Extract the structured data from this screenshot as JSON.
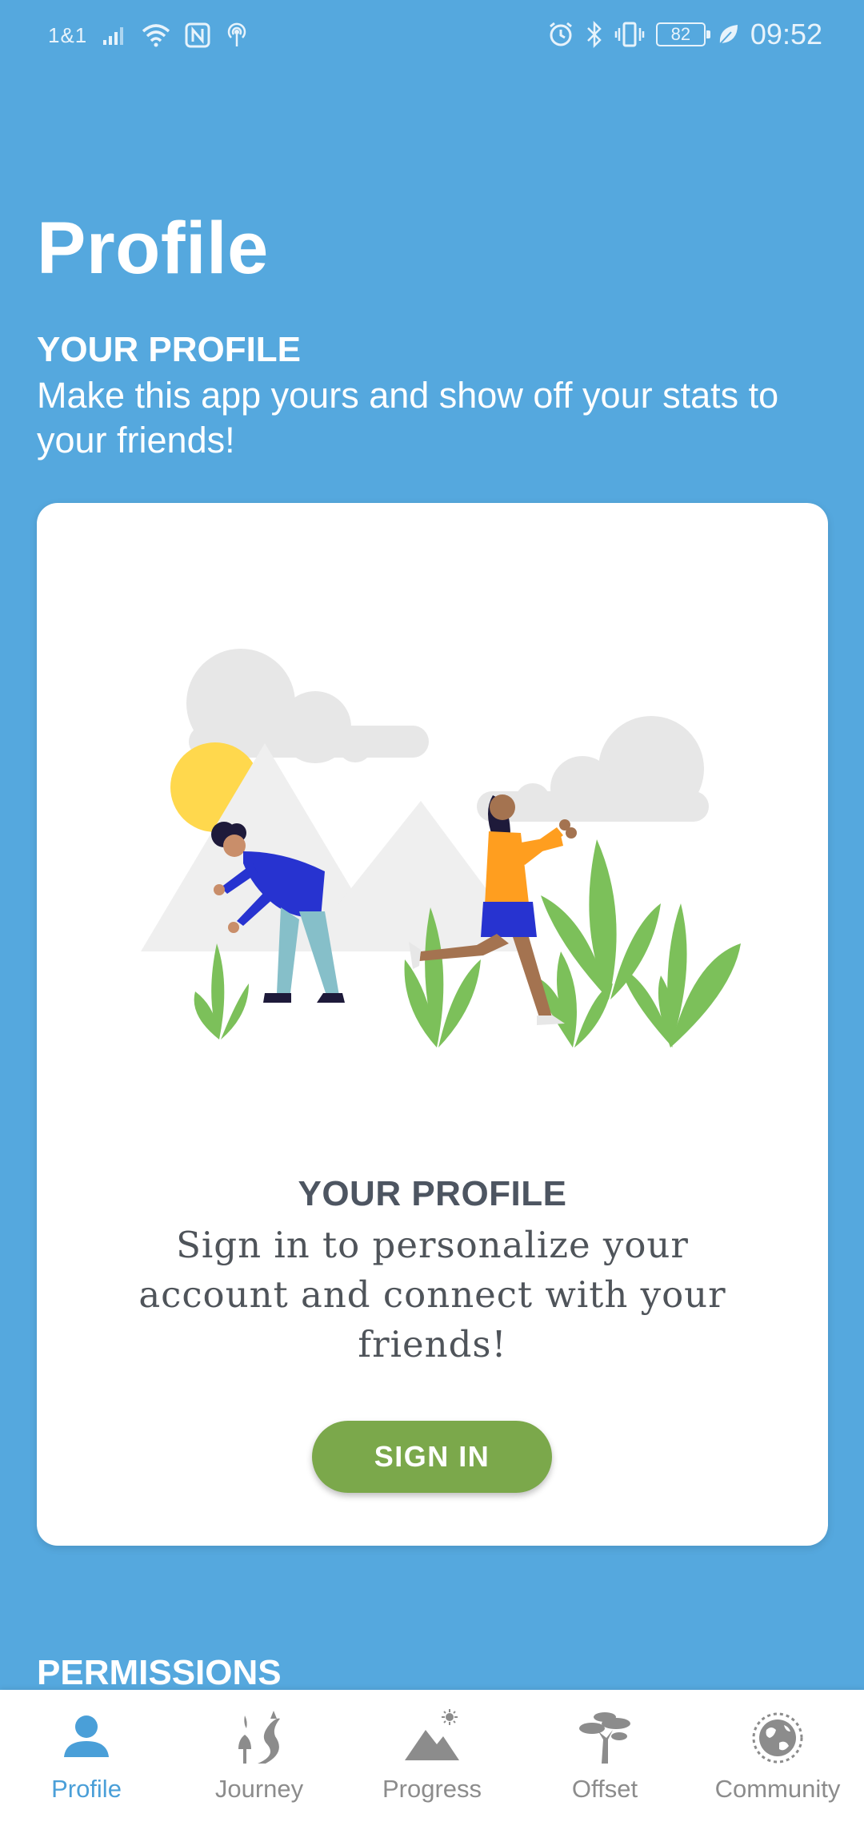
{
  "status_bar": {
    "carrier": "1&1",
    "battery": "82",
    "time": "09:52",
    "icons": [
      "signal-icon",
      "wifi-icon",
      "nfc-icon",
      "hotspot-icon",
      "alarm-icon",
      "bluetooth-icon",
      "vibrate-icon",
      "battery-icon",
      "leaf-icon"
    ]
  },
  "header": {
    "title": "Profile",
    "section_heading": "YOUR PROFILE",
    "section_subtitle": "Make this app yours and show off your stats to your friends!"
  },
  "card": {
    "heading": "YOUR PROFILE",
    "text": "Sign in to personalize your account and connect with your friends!",
    "button_label": "SIGN IN"
  },
  "permissions_heading": "PERMISSIONS",
  "bottom_nav": {
    "items": [
      {
        "label": "Profile",
        "icon": "person-icon",
        "active": true
      },
      {
        "label": "Journey",
        "icon": "journey-icon",
        "active": false
      },
      {
        "label": "Progress",
        "icon": "mountain-icon",
        "active": false
      },
      {
        "label": "Offset",
        "icon": "tree-icon",
        "active": false
      },
      {
        "label": "Community",
        "icon": "globe-icon",
        "active": false
      }
    ]
  },
  "colors": {
    "background": "#55A8DE",
    "accent": "#4A9FD8",
    "button": "#7BA84B",
    "inactive": "#8C8C8C"
  }
}
